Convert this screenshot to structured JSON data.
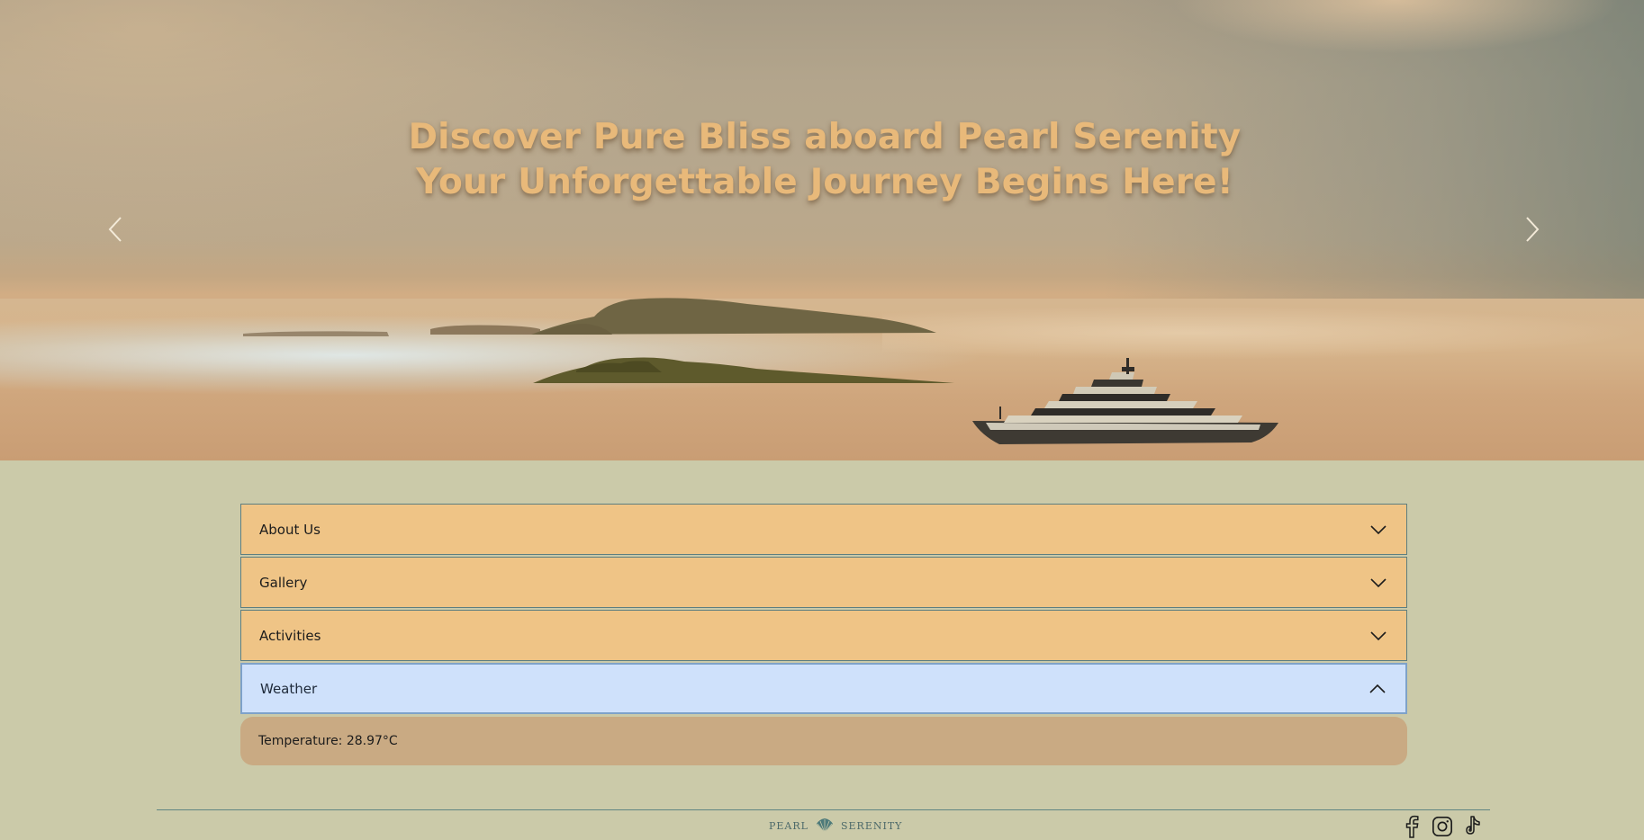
{
  "hero": {
    "title_line1": "Discover Pure Bliss aboard Pearl Serenity",
    "title_line2": "Your Unforgettable Journey Begins Here!",
    "prev_icon": "chevron-left-icon",
    "next_icon": "chevron-right-icon"
  },
  "accordion": {
    "items": [
      {
        "label": "About Us",
        "state": "collapsed",
        "icon": "chevron-down-icon"
      },
      {
        "label": "Gallery",
        "state": "collapsed",
        "icon": "chevron-down-icon"
      },
      {
        "label": "Activities",
        "state": "collapsed",
        "icon": "chevron-down-icon"
      },
      {
        "label": "Weather",
        "state": "expanded",
        "icon": "chevron-up-icon"
      }
    ],
    "weather_panel": {
      "temperature": "Temperature: 28.97°C"
    }
  },
  "footer": {
    "brand_left": "PEARL",
    "brand_right": "SERENITY",
    "brand_icon": "shell-icon",
    "socials": [
      "facebook-icon",
      "instagram-icon",
      "tiktok-icon"
    ]
  },
  "colors": {
    "page_bg": "#cbcaa9",
    "accordion_bg": "#efc486",
    "accordion_open_bg": "#cfe1fb",
    "panel_bg": "#c9aa83",
    "title_color": "#e8b97a",
    "accent_teal": "#4d6a6a"
  }
}
